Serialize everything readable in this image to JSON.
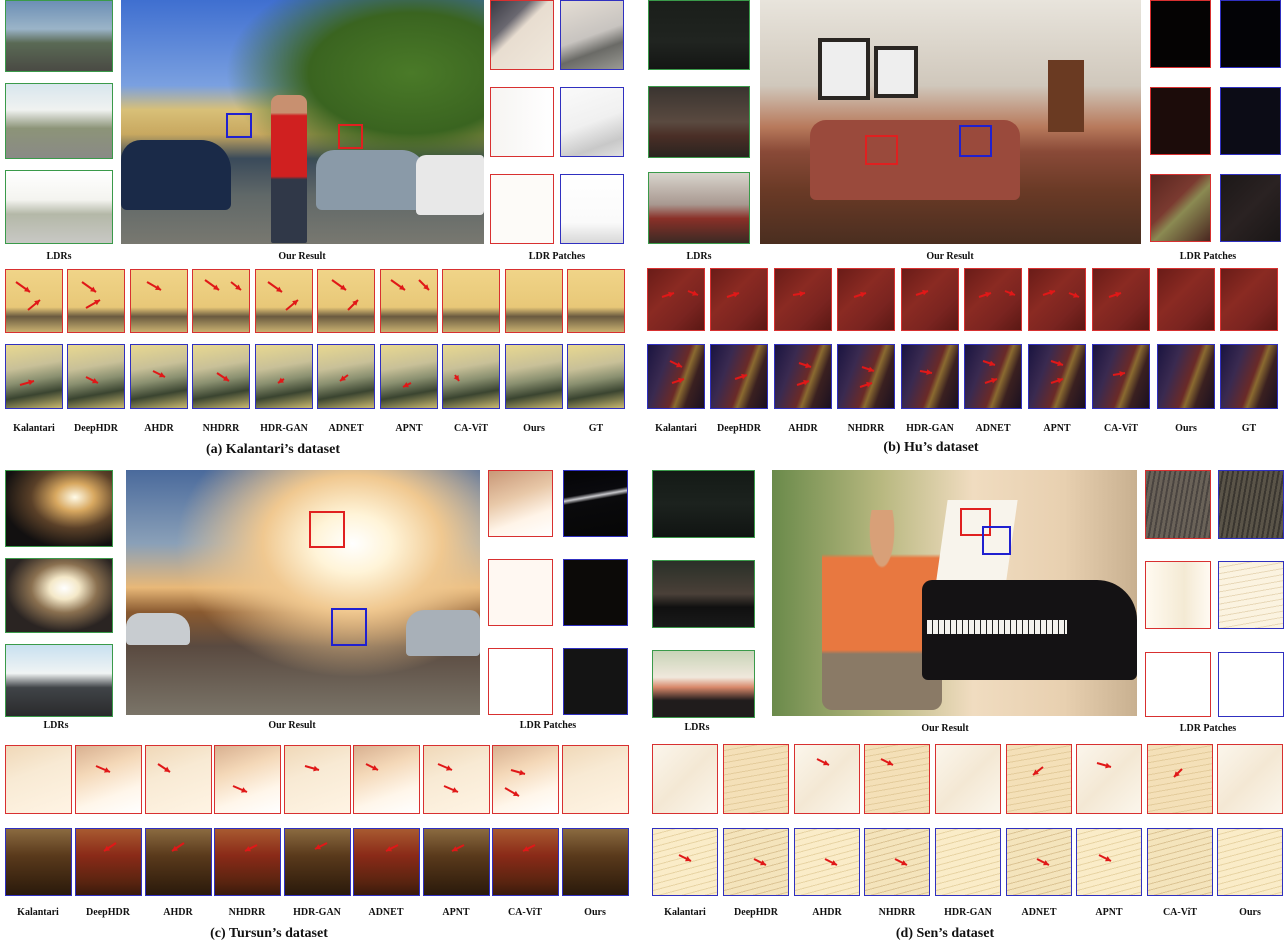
{
  "panels": {
    "a": {
      "caption": "(a) Kalantari’s dataset",
      "ldrs": "LDRs",
      "result": "Our Result",
      "patches": "LDR Patches"
    },
    "b": {
      "caption": "(b) Hu’s dataset",
      "ldrs": "LDRs",
      "result": "Our Result",
      "patches": "LDR Patches"
    },
    "c": {
      "caption": "(c) Tursun’s dataset",
      "ldrs": "LDRs",
      "result": "Our Result",
      "patches": "LDR Patches"
    },
    "d": {
      "caption": "(d) Sen’s dataset",
      "ldrs": "LDRs",
      "result": "Our Result",
      "patches": "LDR Patches"
    }
  },
  "methods_top": [
    "Kalantari",
    "DeepHDR",
    "AHDR",
    "NHDRR",
    "HDR-GAN",
    "ADNET",
    "APNT",
    "CA-ViT",
    "Ours",
    "GT"
  ],
  "methods_bottom": [
    "Kalantari",
    "DeepHDR",
    "AHDR",
    "NHDRR",
    "HDR-GAN",
    "ADNET",
    "APNT",
    "CA-ViT",
    "Ours"
  ],
  "colors": {
    "ldr_border": "#3a9a4a",
    "red_patch": "#d83030",
    "blue_patch": "#3030c0"
  }
}
